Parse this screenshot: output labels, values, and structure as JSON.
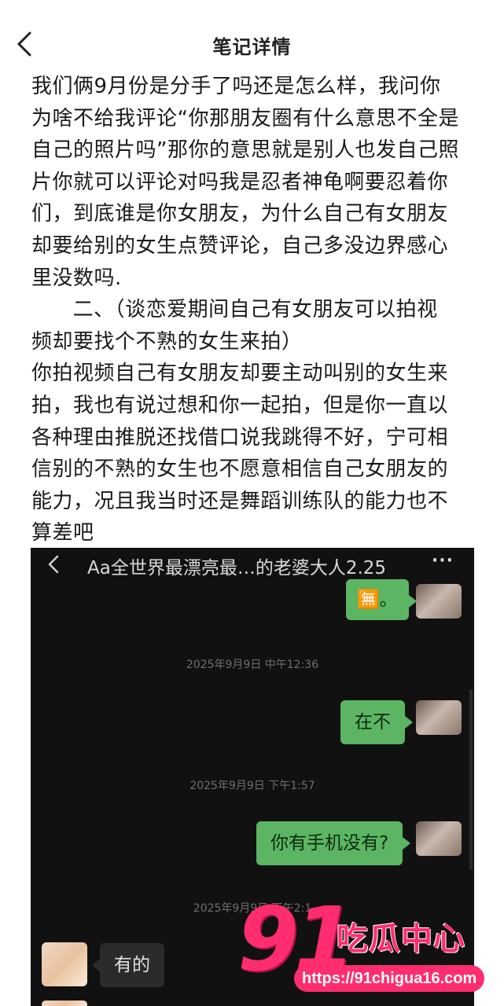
{
  "header": {
    "title": "笔记详情",
    "back_icon": "chevron-left-icon"
  },
  "article": {
    "lines": [
      "我们俩9月份是分手了吗还是怎么样，我问你",
      "为啥不给我评论“你那朋友圈有什么意思不全是",
      "自己的照片吗”那你的意思就是别人也发自己照",
      "片你就可以评论对吗我是忍者神龟啊要忍着你",
      "们，到底谁是你女朋友，为什么自己有女朋友",
      "却要给别的女生点赞评论，自己多没边界感心",
      "里没数吗.",
      "      二、（谈恋爱期间自己有女朋友可以拍视",
      "频却要找个不熟的女生来拍）",
      "你拍视频自己有女朋友却要主动叫别的女生来",
      "拍，我也有说过想和你一起拍，但是你一直以",
      "各种理由推脱还找借口说我跳得不好，宁可相",
      "信别的不熟的女生也不愿意相信自己女朋友的",
      "能力，况且我当时还是舞蹈训练队的能力也不",
      "算差吧"
    ]
  },
  "chat_screenshot": {
    "title": "Aa全世界最漂亮最…的老婆大人2.25",
    "more_label": "···",
    "messages": [
      {
        "type": "out",
        "text": "🈚。"
      },
      {
        "type": "time",
        "text": "2025年9月9日 中午12:36"
      },
      {
        "type": "out",
        "text": "在不"
      },
      {
        "type": "time",
        "text": "2025年9月9日 下午1:57"
      },
      {
        "type": "out",
        "text": "你有手机没有?"
      },
      {
        "type": "time",
        "text": "2025年9月9日 下午2:1"
      },
      {
        "type": "in",
        "text": "有的"
      }
    ]
  },
  "watermark": {
    "number": "91",
    "name": "吃瓜中心",
    "url": "https://91chigua16.com"
  },
  "colors": {
    "bubble_out": "#5bb563",
    "chat_bg": "#111111",
    "watermark": "#ff2d6f"
  }
}
